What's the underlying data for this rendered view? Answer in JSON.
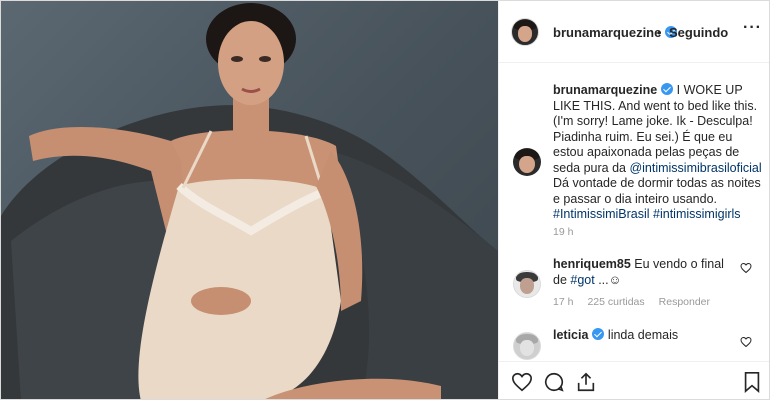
{
  "header": {
    "username": "brunamarquezine",
    "separator": "•",
    "follow_status": "Seguindo",
    "more_icon": "more-horizontal-icon"
  },
  "caption": {
    "username": "brunamarquezine",
    "text_before_mention": "I WOKE UP LIKE THIS. And went to bed like this. (I'm sorry! Lame joke. Ik - Desculpa! Piadinha ruim. Eu sei.) É que eu estou apaixonada pelas peças de seda pura da ",
    "mention": "@intimissimibrasiloficial",
    "text_after_mention": " Dá vontade de dormir todas as noites e passar o dia inteiro usando. ",
    "hashtag1": "#IntimissimiBrasil",
    "hashtag2": "#intimissimigirls",
    "time": "19 h"
  },
  "comments": [
    {
      "username": "henriquem85",
      "text": "Eu vendo o final de ",
      "hashtag": "#got",
      "suffix": " ...☺",
      "time": "17 h",
      "likes": "225 curtidas",
      "reply": "Responder"
    },
    {
      "username": "leticia",
      "text": "linda demais"
    }
  ],
  "colors": {
    "verified": "#3897f0",
    "link": "#003569",
    "muted": "#999999",
    "border": "#efefef"
  },
  "icons": {
    "like": "heart-icon",
    "comment": "comment-icon",
    "share": "share-icon",
    "save": "bookmark-icon"
  }
}
